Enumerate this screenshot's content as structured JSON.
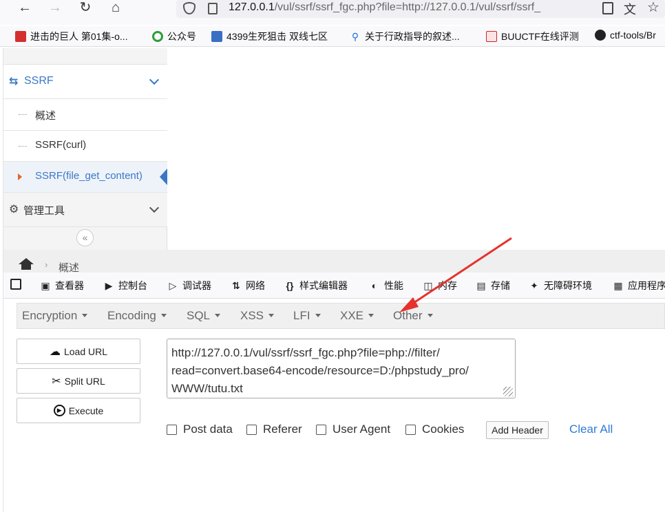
{
  "browser": {
    "url_host": "127.0.0.1",
    "url_path": "/vul/ssrf/ssrf_fgc.php?file=http://127.0.0.1/vul/ssrf/ssrf_"
  },
  "bookmarks": [
    {
      "label": "进击的巨人 第01集-o...",
      "color": "#d32f2f"
    },
    {
      "label": "公众号",
      "color": "#2e9d3c"
    },
    {
      "label": "4399生死狙击 双线七区",
      "color": "#3a6fc4"
    },
    {
      "label": "关于行政指导的叙述...",
      "color": "#1a6fd8"
    },
    {
      "label": "BUUCTF在线评测",
      "color": "#c62828"
    },
    {
      "label": "ctf-tools/Br",
      "color": "#222222"
    }
  ],
  "sidebar": {
    "ssrf_title": "SSRF",
    "items": [
      "概述",
      "SSRF(curl)",
      "SSRF(file_get_content)"
    ],
    "admin_title": "管理工具",
    "accent": "#3a78c6"
  },
  "breadcrumb": {
    "current": "概述"
  },
  "devtools": {
    "tabs": [
      "查看器",
      "控制台",
      "调试器",
      "网络",
      "样式编辑器",
      "性能",
      "内存",
      "存储",
      "无障碍环境",
      "应用程序"
    ]
  },
  "hackbar": {
    "menus": [
      "Encryption",
      "Encoding",
      "SQL",
      "XSS",
      "LFI",
      "XXE",
      "Other"
    ],
    "buttons": {
      "load": "Load URL",
      "split": "Split URL",
      "execute": "Execute"
    },
    "url_value": "http://127.0.0.1/vul/ssrf/ssrf_fgc.php?file=php://filter/\nread=convert.base64-encode/resource=D:/phpstudy_pro/\nWWW/tutu.txt",
    "options": [
      "Post data",
      "Referer",
      "User Agent",
      "Cookies"
    ],
    "add_header": "Add Header",
    "clear_all": "Clear All"
  },
  "annotation_color": "#e5322d"
}
